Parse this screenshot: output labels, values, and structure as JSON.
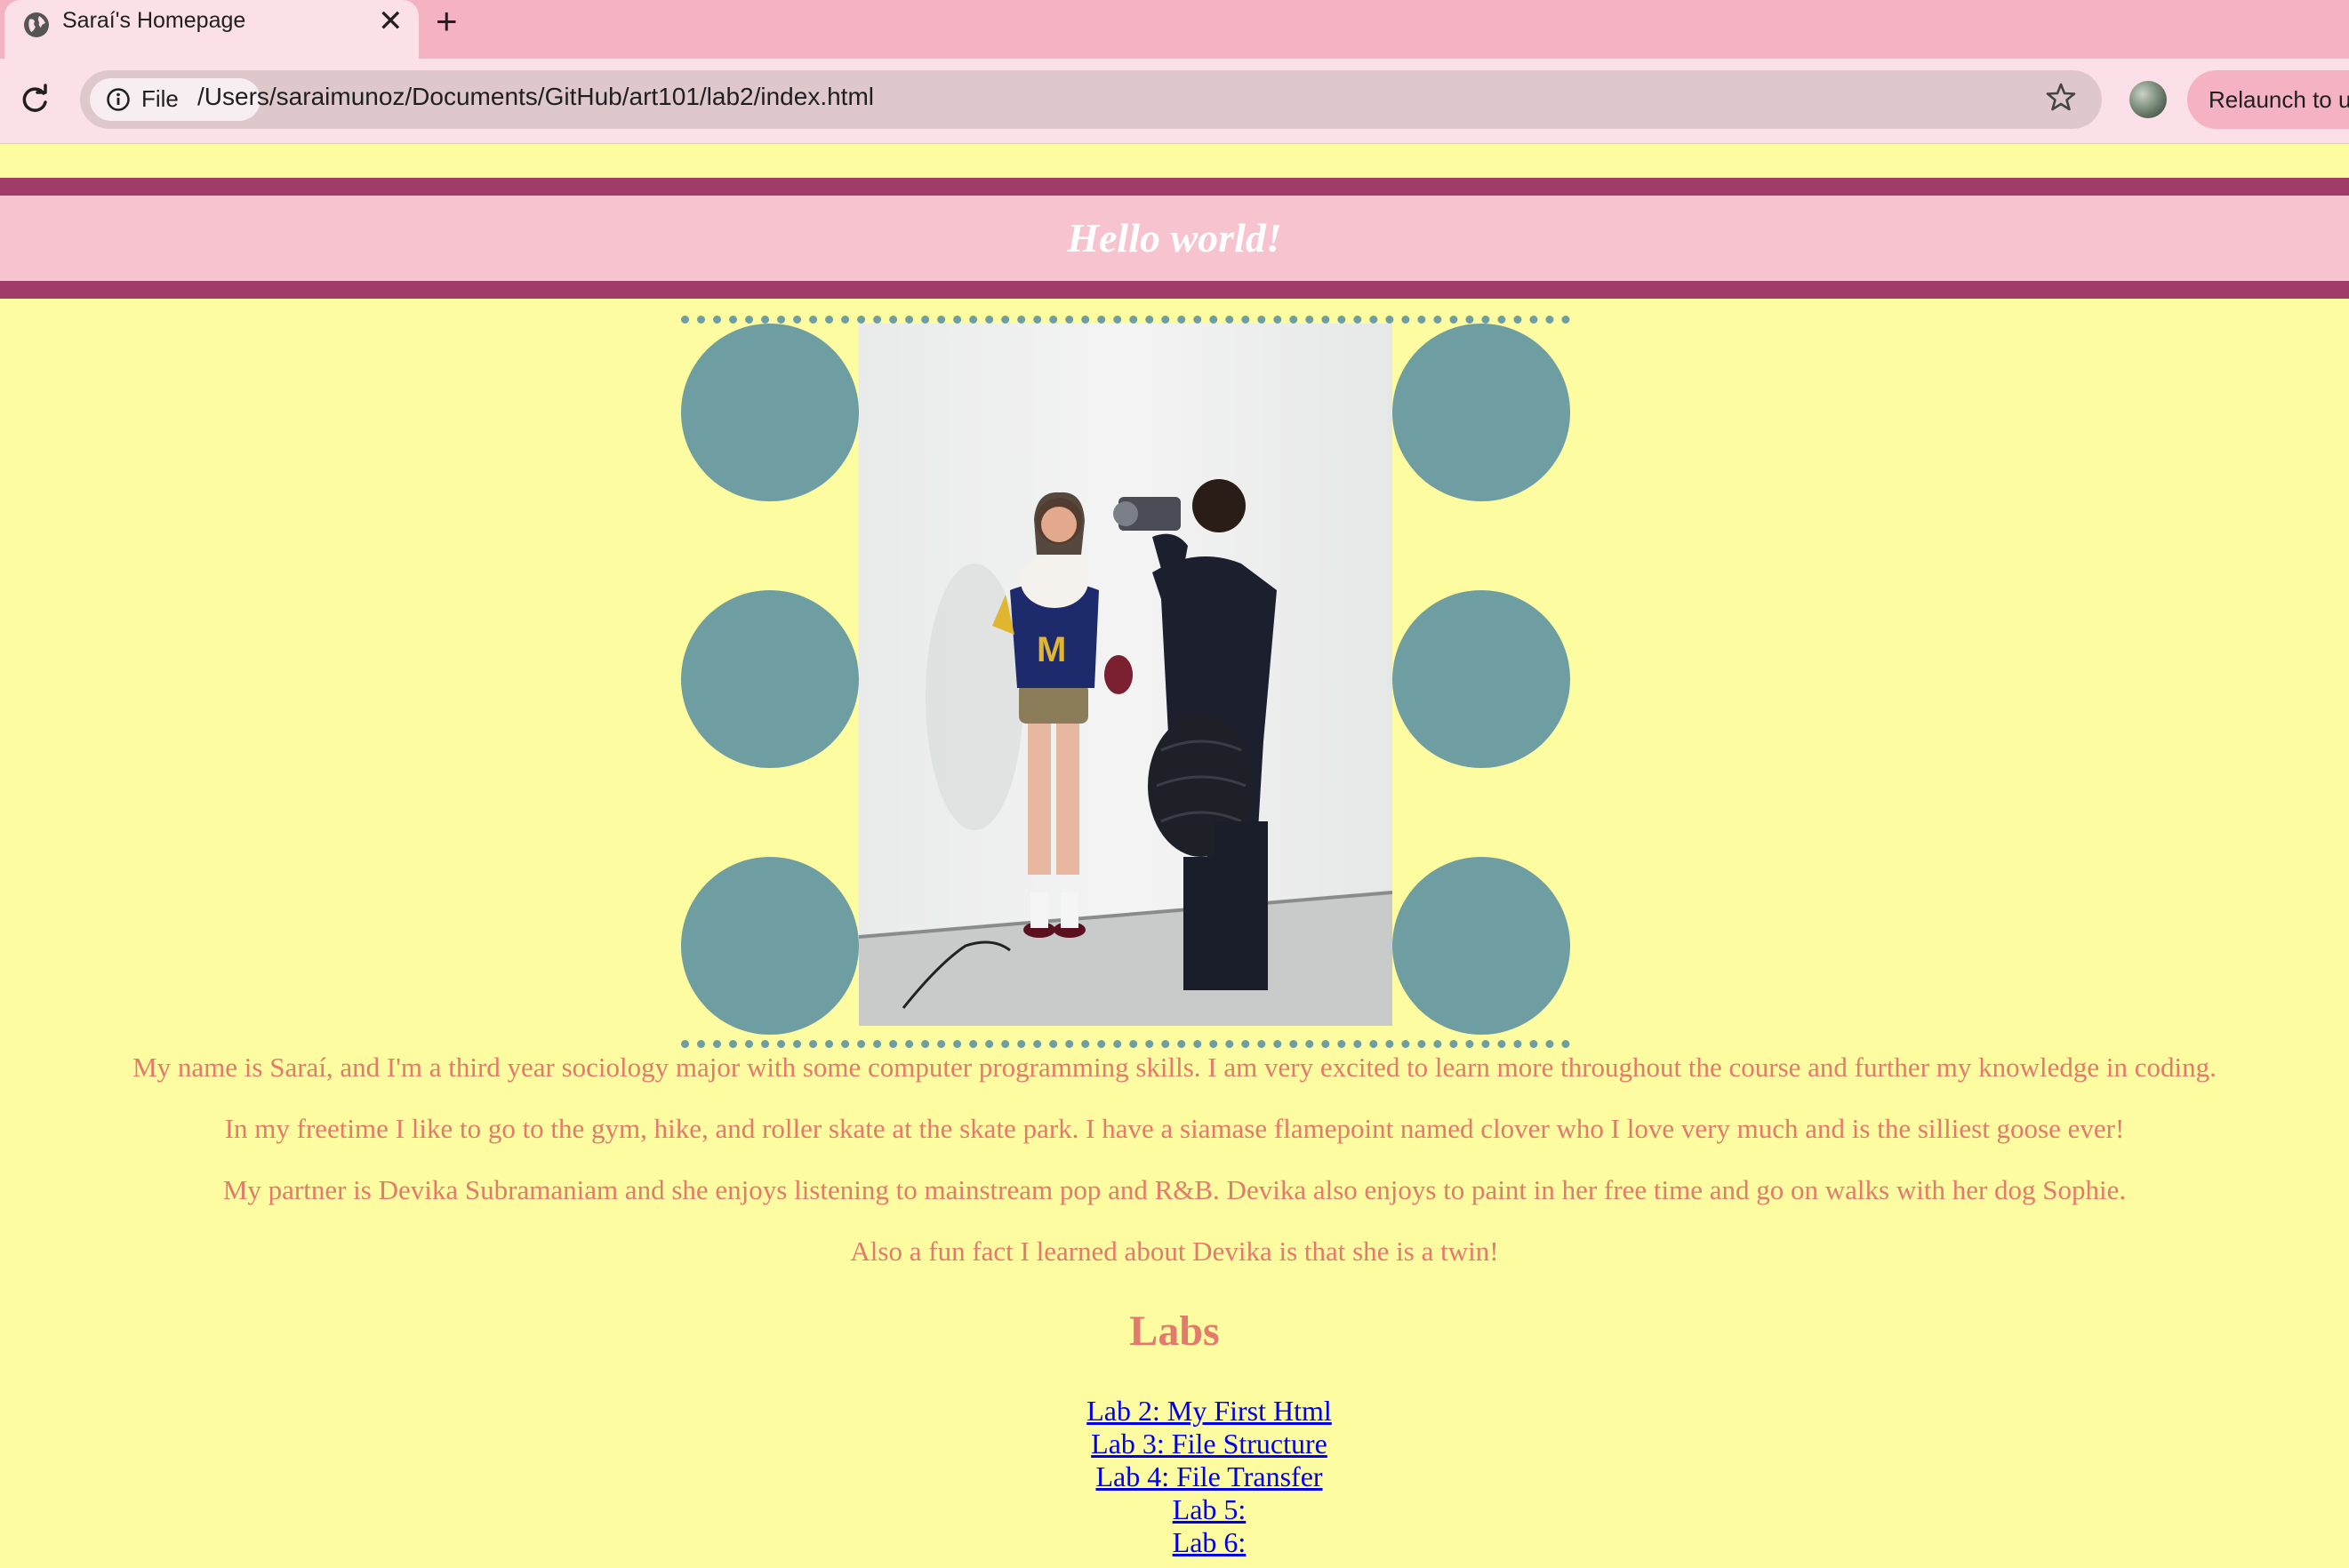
{
  "browser": {
    "tab_title": "Saraí's Homepage",
    "tab_close": "✕",
    "new_tab": "+",
    "site_info_label": "File",
    "url": "/Users/saraimunoz/Documents/GitHub/art101/lab2/index.html",
    "relaunch_label": "Relaunch to u"
  },
  "page": {
    "heading": "Hello world!",
    "photo_alt": "Photo of Saraí holding a white cat while a person films her with a camcorder",
    "bio": [
      "My name is Saraí, and I'm a third year sociology major with some computer programming skills. I am very excited to learn more throughout the course and further my knowledge in coding.",
      "In my freetime I like to go to the gym, hike, and roller skate at the skate park. I have a siamase flamepoint named clover who I love very much and is the silliest goose ever!",
      "My partner is Devika Subramaniam and she enjoys listening to mainstream pop and R&B. Devika also enjoys to paint in her free time and go on walks with her dog Sophie.",
      "Also a fun fact I learned about Devika is that she is a twin!"
    ],
    "labs_title": "Labs",
    "labs": [
      "Lab 2: My First Html",
      "Lab 3: File Structure",
      "Lab 4: File Transfer",
      "Lab 5:",
      "Lab 6:"
    ]
  },
  "colors": {
    "page_bg": "#fdfca0",
    "header_bg": "#f7c3ce",
    "header_border": "#a13b68",
    "accent_teal": "#6f9ea2",
    "text_coral": "#e27a6e",
    "link": "#0000ee"
  }
}
